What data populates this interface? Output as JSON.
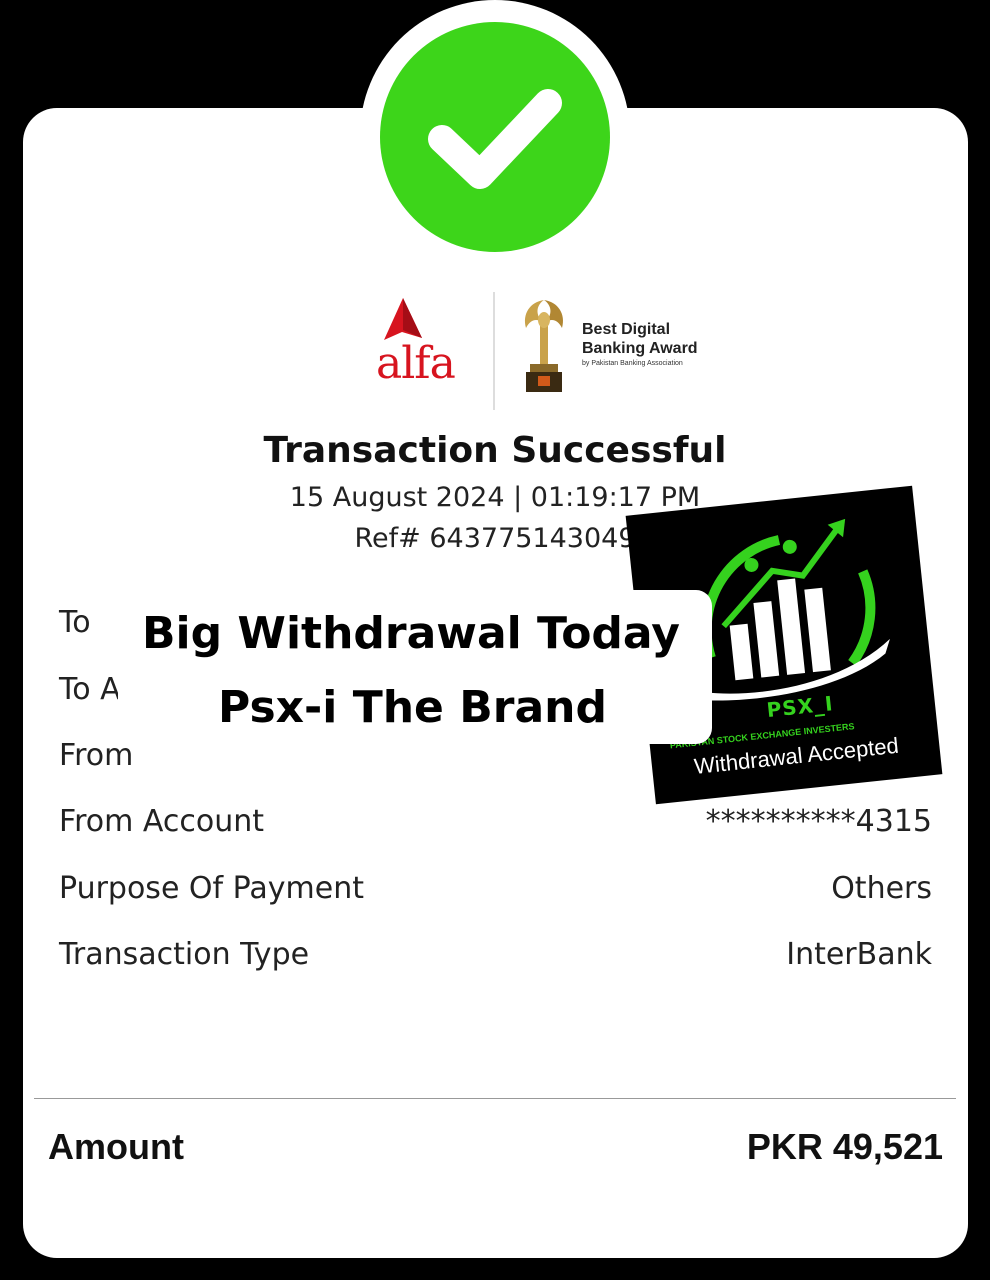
{
  "status": {
    "title": "Transaction Successful",
    "datetime": "15 August 2024 | 01:19:17 PM",
    "ref": "Ref# 643775143049"
  },
  "brand": {
    "logo_text": "alfa",
    "award_title_line1": "Best Digital",
    "award_title_line2": "Banking Award",
    "award_subtitle": "by Pakistan Banking Association"
  },
  "details": {
    "rows": [
      {
        "label": "To",
        "value": ""
      },
      {
        "label": "To A",
        "value": ""
      },
      {
        "label": "From",
        "value": ""
      },
      {
        "label": "From Account",
        "value": "**********4315"
      },
      {
        "label": "Purpose Of Payment",
        "value": "Others"
      },
      {
        "label": "Transaction Type",
        "value": "InterBank"
      }
    ]
  },
  "amount": {
    "label": "Amount",
    "value": "PKR 49,521"
  },
  "overlay": {
    "line1": "Big Withdrawal Today",
    "line2": "Psx-i The Brand"
  },
  "badge": {
    "name": "PSX_I",
    "subtitle": "PAKISTAN STOCK EXCHANGE INVESTERS",
    "caption": "Withdrawal Accepted"
  },
  "colors": {
    "success_green": "#3dd51a",
    "alfa_red": "#d7141f",
    "psx_green": "#35d21e"
  },
  "icons": {
    "status": "checkmark-icon",
    "trophy": "trophy-icon"
  }
}
